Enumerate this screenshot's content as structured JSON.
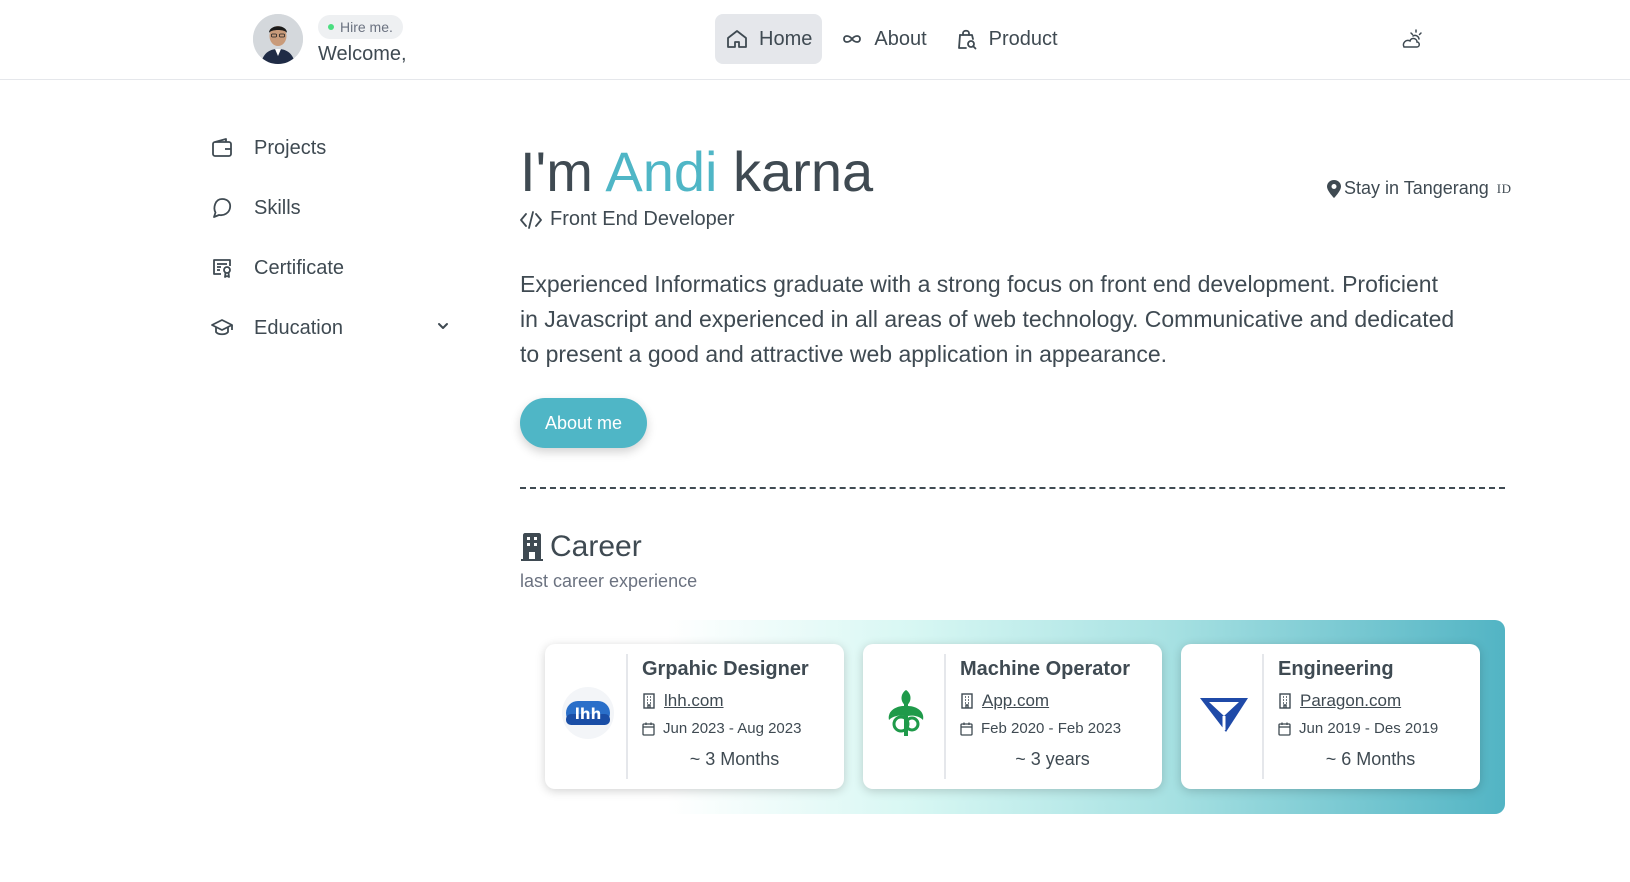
{
  "header": {
    "hire_label": "Hire me.",
    "welcome": "Welcome,",
    "nav": [
      {
        "label": "Home",
        "icon": "home-icon",
        "active": true
      },
      {
        "label": "About",
        "icon": "infinity-icon",
        "active": false
      },
      {
        "label": "Product",
        "icon": "shopping-bag-icon",
        "active": false
      }
    ],
    "theme_icon": "cloud-sun-icon"
  },
  "sidebar": {
    "items": [
      {
        "label": "Projects",
        "icon": "wallet-icon"
      },
      {
        "label": "Skills",
        "icon": "chat-bubble-icon"
      },
      {
        "label": "Certificate",
        "icon": "certificate-icon"
      },
      {
        "label": "Education",
        "icon": "graduation-cap-icon",
        "expandable": true
      }
    ]
  },
  "hero": {
    "prefix": "I'm",
    "first_name": "Andi",
    "last_name": "karna",
    "role": "Front End Developer",
    "location": "Stay in Tangerang",
    "country_code": "ID",
    "description": "Experienced Informatics graduate with a strong focus on front end development. Proficient in Javascript and experienced in all areas of web technology. Communicative and dedicated to present a good and attractive web application in appearance.",
    "about_button": "About me"
  },
  "career": {
    "title": "Career",
    "subtitle": "last career experience",
    "jobs": [
      {
        "title": "Grpahic Designer",
        "site": "lhh.com",
        "period": "Jun 2023 - Aug 2023",
        "duration": "~ 3 Months",
        "logo": "lhh-logo"
      },
      {
        "title": "Machine Operator",
        "site": "App.com",
        "period": "Feb 2020 - Feb 2023",
        "duration": "~ 3 years",
        "logo": "app-logo"
      },
      {
        "title": "Engineering",
        "site": "Paragon.com",
        "period": "Jun 2019 - Des 2019",
        "duration": "~ 6 Months",
        "logo": "paragon-logo"
      }
    ]
  },
  "colors": {
    "accent": "#4fb6c6",
    "text": "#3f4a52",
    "online_dot": "#4ade80"
  }
}
